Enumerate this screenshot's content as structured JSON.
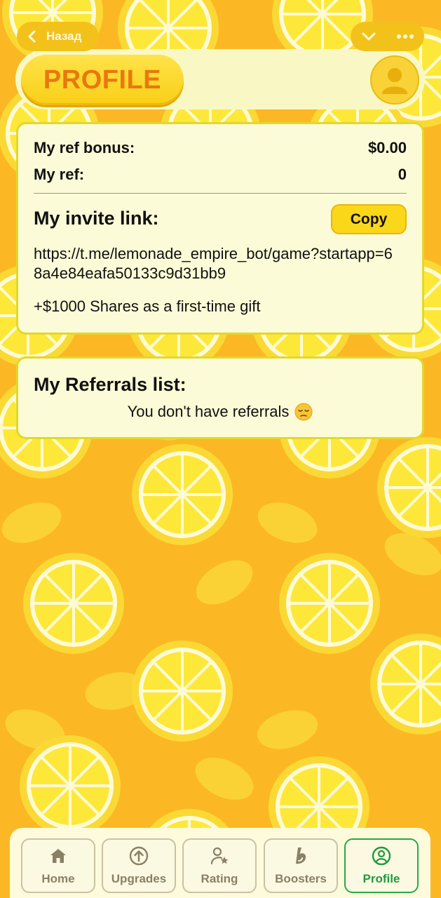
{
  "telegram_bar": {
    "back_label": "Назад"
  },
  "header": {
    "title": "PROFILE"
  },
  "stats": {
    "ref_bonus_label": "My ref bonus:",
    "ref_bonus_value": "$0.00",
    "ref_count_label": "My ref:",
    "ref_count_value": "0"
  },
  "invite": {
    "title": "My invite link:",
    "copy_label": "Copy",
    "link": "https://t.me/lemonade_empire_bot/game?startapp=68a4e84eafa50133c9d31bb9",
    "gift_text": "+$1000 Shares as a first-time gift"
  },
  "referrals": {
    "title": "My Referrals list:",
    "empty_text": "You don't have referrals"
  },
  "nav": {
    "tabs": [
      {
        "label": "Home",
        "icon": "home-icon"
      },
      {
        "label": "Upgrades",
        "icon": "arrow-up-circle-icon"
      },
      {
        "label": "Rating",
        "icon": "user-star-icon"
      },
      {
        "label": "Boosters",
        "icon": "booster-icon"
      },
      {
        "label": "Profile",
        "icon": "user-circle-icon",
        "active": true
      }
    ]
  },
  "colors": {
    "background": "#fbb824",
    "card": "#fcfbd7",
    "title_orange": "#e9780e",
    "active_green": "#1f9a3e"
  }
}
